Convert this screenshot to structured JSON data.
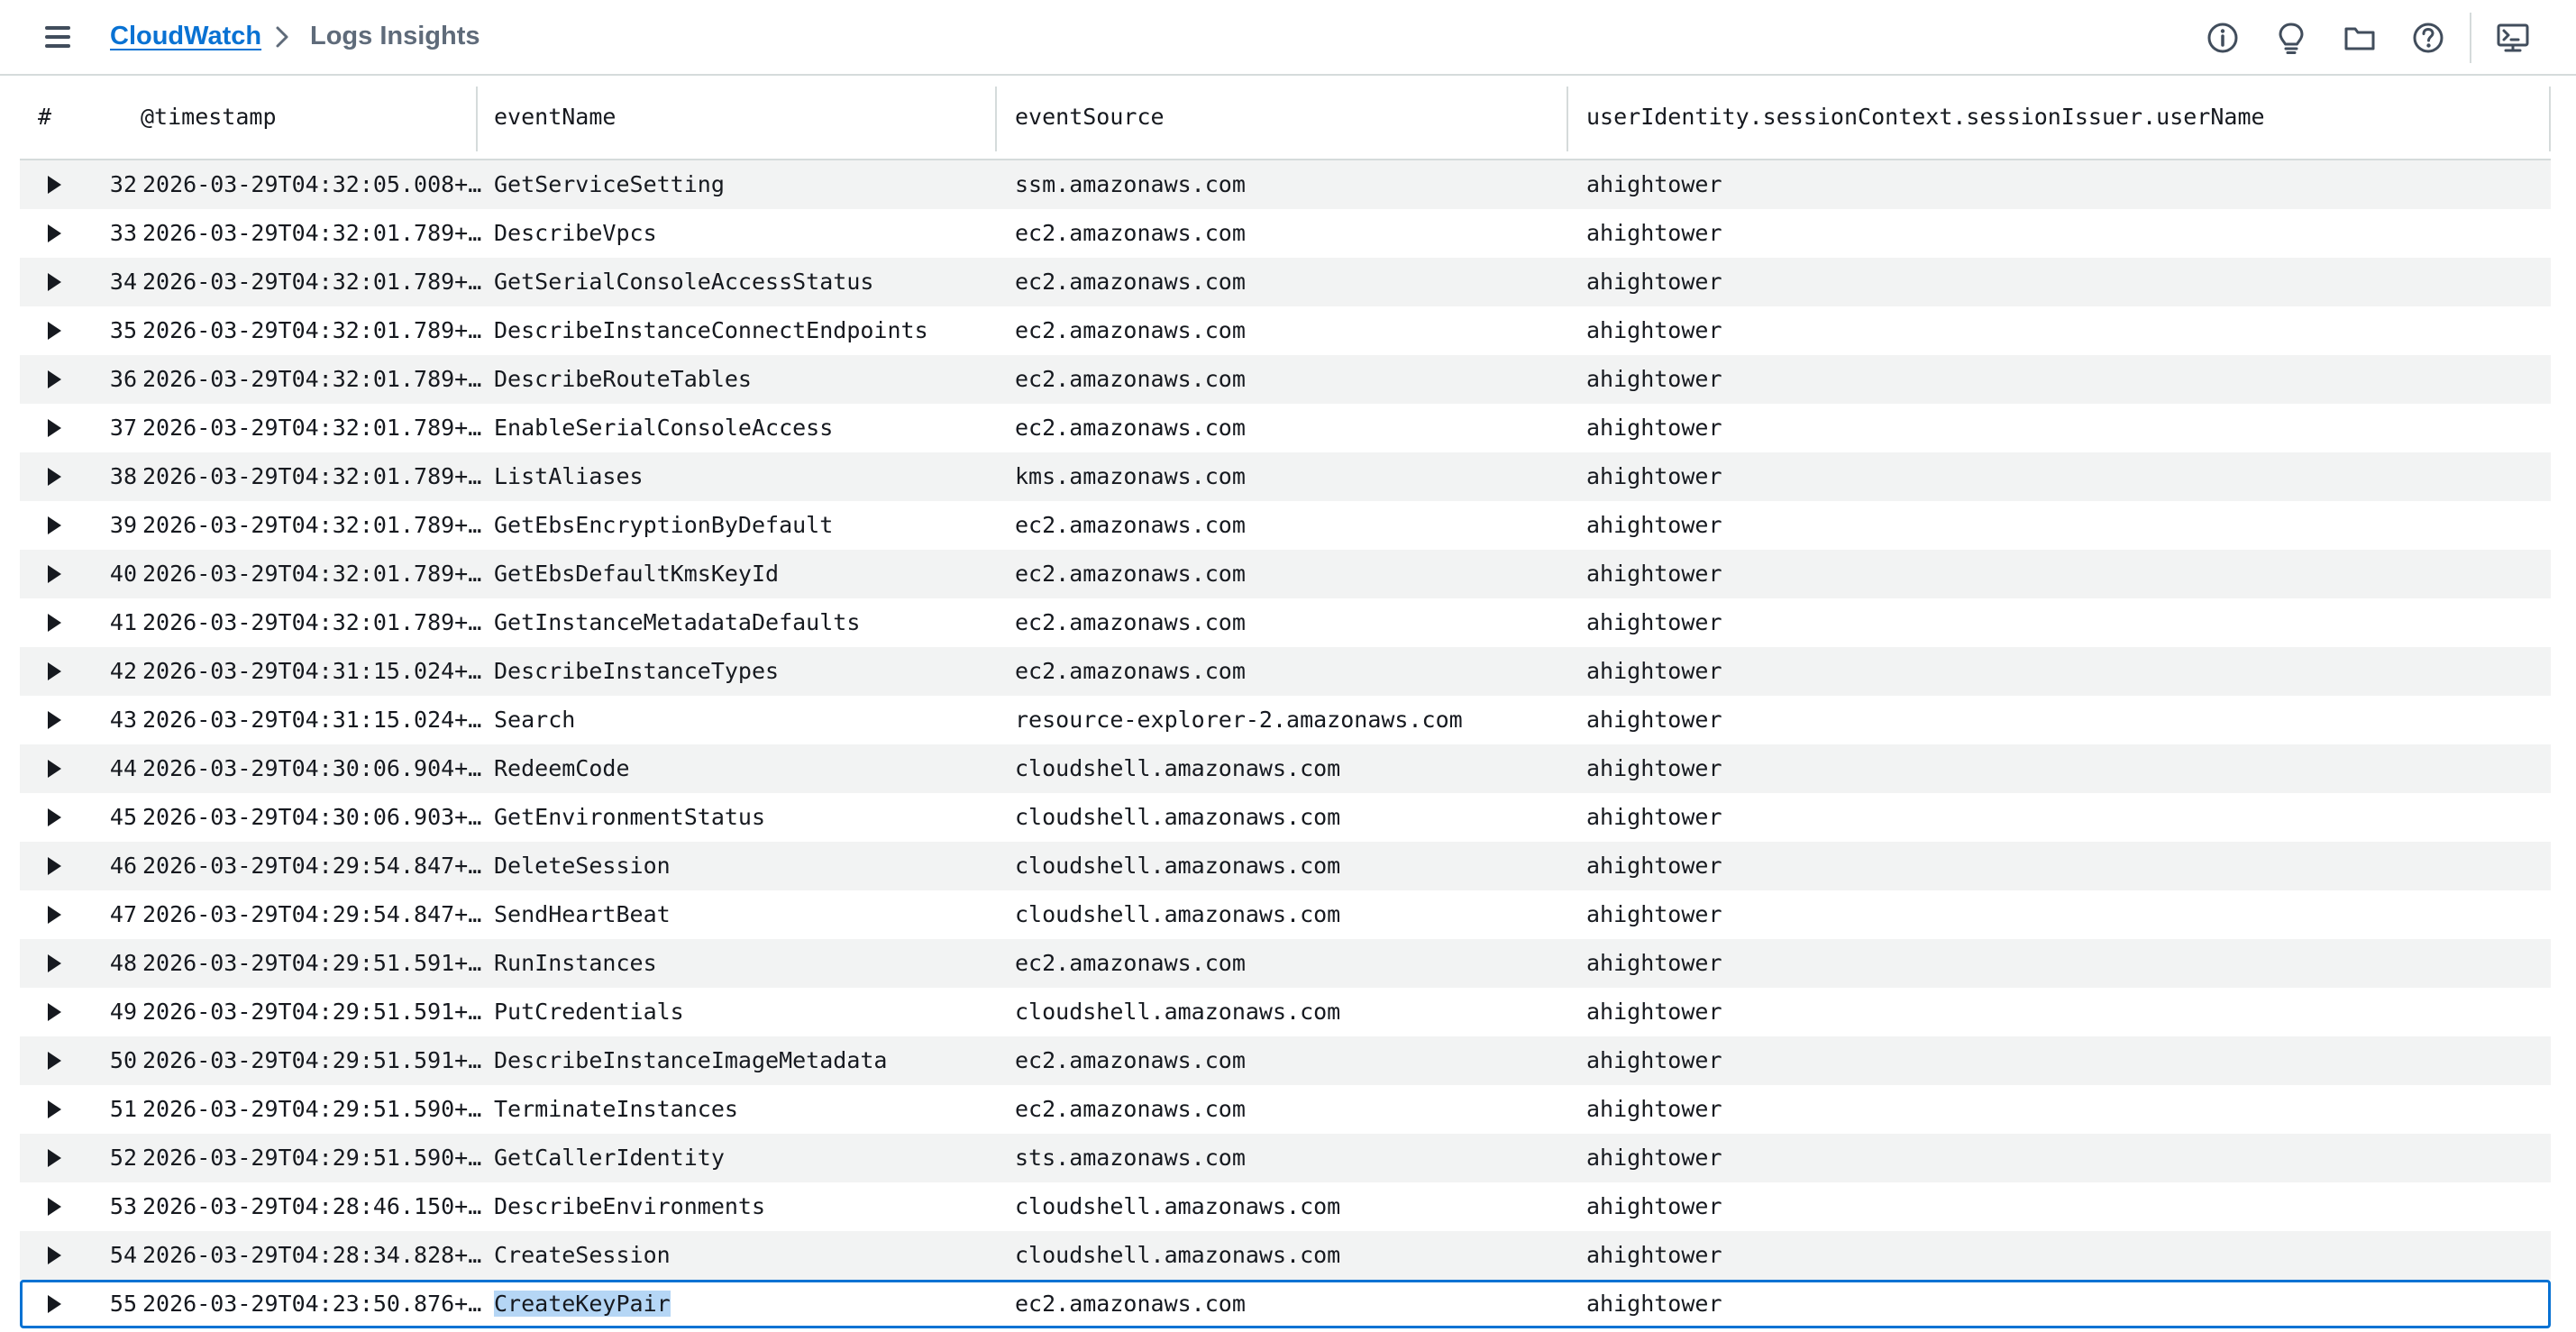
{
  "breadcrumb": {
    "root": "CloudWatch",
    "current": "Logs Insights"
  },
  "toolbar_icons": [
    "info-icon",
    "lightbulb-icon",
    "folder-icon",
    "help-icon",
    "cloudshell-icon"
  ],
  "table": {
    "columns": [
      "#",
      "@timestamp",
      "eventName",
      "eventSource",
      "userIdentity.sessionContext.sessionIssuer.userName"
    ],
    "rows": [
      {
        "num": "32",
        "timestamp": "2026-03-29T04:32:05.008+…",
        "eventName": "GetServiceSetting",
        "eventSource": "ssm.amazonaws.com",
        "userName": "ahightower"
      },
      {
        "num": "33",
        "timestamp": "2026-03-29T04:32:01.789+…",
        "eventName": "DescribeVpcs",
        "eventSource": "ec2.amazonaws.com",
        "userName": "ahightower"
      },
      {
        "num": "34",
        "timestamp": "2026-03-29T04:32:01.789+…",
        "eventName": "GetSerialConsoleAccessStatus",
        "eventSource": "ec2.amazonaws.com",
        "userName": "ahightower"
      },
      {
        "num": "35",
        "timestamp": "2026-03-29T04:32:01.789+…",
        "eventName": "DescribeInstanceConnectEndpoints",
        "eventSource": "ec2.amazonaws.com",
        "userName": "ahightower"
      },
      {
        "num": "36",
        "timestamp": "2026-03-29T04:32:01.789+…",
        "eventName": "DescribeRouteTables",
        "eventSource": "ec2.amazonaws.com",
        "userName": "ahightower"
      },
      {
        "num": "37",
        "timestamp": "2026-03-29T04:32:01.789+…",
        "eventName": "EnableSerialConsoleAccess",
        "eventSource": "ec2.amazonaws.com",
        "userName": "ahightower"
      },
      {
        "num": "38",
        "timestamp": "2026-03-29T04:32:01.789+…",
        "eventName": "ListAliases",
        "eventSource": "kms.amazonaws.com",
        "userName": "ahightower"
      },
      {
        "num": "39",
        "timestamp": "2026-03-29T04:32:01.789+…",
        "eventName": "GetEbsEncryptionByDefault",
        "eventSource": "ec2.amazonaws.com",
        "userName": "ahightower"
      },
      {
        "num": "40",
        "timestamp": "2026-03-29T04:32:01.789+…",
        "eventName": "GetEbsDefaultKmsKeyId",
        "eventSource": "ec2.amazonaws.com",
        "userName": "ahightower"
      },
      {
        "num": "41",
        "timestamp": "2026-03-29T04:32:01.789+…",
        "eventName": "GetInstanceMetadataDefaults",
        "eventSource": "ec2.amazonaws.com",
        "userName": "ahightower"
      },
      {
        "num": "42",
        "timestamp": "2026-03-29T04:31:15.024+…",
        "eventName": "DescribeInstanceTypes",
        "eventSource": "ec2.amazonaws.com",
        "userName": "ahightower"
      },
      {
        "num": "43",
        "timestamp": "2026-03-29T04:31:15.024+…",
        "eventName": "Search",
        "eventSource": "resource-explorer-2.amazonaws.com",
        "userName": "ahightower"
      },
      {
        "num": "44",
        "timestamp": "2026-03-29T04:30:06.904+…",
        "eventName": "RedeemCode",
        "eventSource": "cloudshell.amazonaws.com",
        "userName": "ahightower"
      },
      {
        "num": "45",
        "timestamp": "2026-03-29T04:30:06.903+…",
        "eventName": "GetEnvironmentStatus",
        "eventSource": "cloudshell.amazonaws.com",
        "userName": "ahightower"
      },
      {
        "num": "46",
        "timestamp": "2026-03-29T04:29:54.847+…",
        "eventName": "DeleteSession",
        "eventSource": "cloudshell.amazonaws.com",
        "userName": "ahightower"
      },
      {
        "num": "47",
        "timestamp": "2026-03-29T04:29:54.847+…",
        "eventName": "SendHeartBeat",
        "eventSource": "cloudshell.amazonaws.com",
        "userName": "ahightower"
      },
      {
        "num": "48",
        "timestamp": "2026-03-29T04:29:51.591+…",
        "eventName": "RunInstances",
        "eventSource": "ec2.amazonaws.com",
        "userName": "ahightower"
      },
      {
        "num": "49",
        "timestamp": "2026-03-29T04:29:51.591+…",
        "eventName": "PutCredentials",
        "eventSource": "cloudshell.amazonaws.com",
        "userName": "ahightower"
      },
      {
        "num": "50",
        "timestamp": "2026-03-29T04:29:51.591+…",
        "eventName": "DescribeInstanceImageMetadata",
        "eventSource": "ec2.amazonaws.com",
        "userName": "ahightower"
      },
      {
        "num": "51",
        "timestamp": "2026-03-29T04:29:51.590+…",
        "eventName": "TerminateInstances",
        "eventSource": "ec2.amazonaws.com",
        "userName": "ahightower"
      },
      {
        "num": "52",
        "timestamp": "2026-03-29T04:29:51.590+…",
        "eventName": "GetCallerIdentity",
        "eventSource": "sts.amazonaws.com",
        "userName": "ahightower"
      },
      {
        "num": "53",
        "timestamp": "2026-03-29T04:28:46.150+…",
        "eventName": "DescribeEnvironments",
        "eventSource": "cloudshell.amazonaws.com",
        "userName": "ahightower"
      },
      {
        "num": "54",
        "timestamp": "2026-03-29T04:28:34.828+…",
        "eventName": "CreateSession",
        "eventSource": "cloudshell.amazonaws.com",
        "userName": "ahightower"
      },
      {
        "num": "55",
        "timestamp": "2026-03-29T04:23:50.876+…",
        "eventName": "CreateKeyPair",
        "eventSource": "ec2.amazonaws.com",
        "userName": "ahightower",
        "selected": true
      }
    ]
  },
  "colors": {
    "link": "#0972d3",
    "selection_outline": "#0972d3",
    "text_highlight": "#b5d6f5",
    "row_stripe": "#f2f3f3",
    "border": "#d5dbdb"
  }
}
